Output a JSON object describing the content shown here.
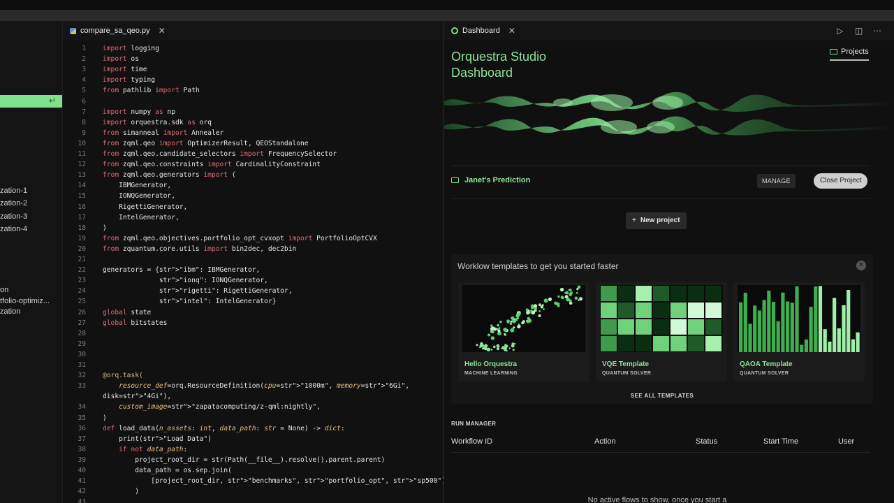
{
  "sidebar": {
    "items": [
      "zation-1",
      "zation-2",
      "zation-3",
      "zation-4",
      "on",
      "tfolio-optimiz...",
      "zation"
    ]
  },
  "editor": {
    "tab_label": "compare_sa_qeo.py",
    "lines": [
      {
        "n": "1",
        "code": "import logging"
      },
      {
        "n": "2",
        "code": "import os"
      },
      {
        "n": "3",
        "code": "import time"
      },
      {
        "n": "4",
        "code": "import typing"
      },
      {
        "n": "5",
        "code": "from pathlib import Path"
      },
      {
        "n": "6",
        "code": ""
      },
      {
        "n": "7",
        "code": "import numpy as np"
      },
      {
        "n": "8",
        "code": "import orquestra.sdk as orq"
      },
      {
        "n": "9",
        "code": "from simanneal import Annealer"
      },
      {
        "n": "10",
        "code": "from zqml.qeo import OptimizerResult, QEOStandalone"
      },
      {
        "n": "11",
        "code": "from zqml.qeo.candidate_selectors import FrequencySelector"
      },
      {
        "n": "12",
        "code": "from zqml.qeo.constraints import CardinalityConstraint"
      },
      {
        "n": "13",
        "code": "from zqml.qeo.generators import ("
      },
      {
        "n": "14",
        "code": "    IBMGenerator,"
      },
      {
        "n": "15",
        "code": "    IONQGenerator,"
      },
      {
        "n": "16",
        "code": "    RigettiGenerator,"
      },
      {
        "n": "17",
        "code": "    IntelGenerator,"
      },
      {
        "n": "18",
        "code": ")"
      },
      {
        "n": "19",
        "code": "from zqml.qeo.objectives.portfolio_opt_cvxopt import PortfolioOptCVX"
      },
      {
        "n": "20",
        "code": "from zquantum.core.utils import bin2dec, dec2bin"
      },
      {
        "n": "21",
        "code": ""
      },
      {
        "n": "22",
        "code": "generators = {\"ibm\": IBMGenerator,"
      },
      {
        "n": "23",
        "code": "              \"ionq\": IONQGenerator,"
      },
      {
        "n": "24",
        "code": "              \"rigetti\": RigettiGenerator,"
      },
      {
        "n": "25",
        "code": "              \"intel\": IntelGenerator}"
      },
      {
        "n": "26",
        "code": "global state"
      },
      {
        "n": "27",
        "code": "global bitstates"
      },
      {
        "n": "28",
        "code": ""
      },
      {
        "n": "29",
        "code": ""
      },
      {
        "n": "30",
        "code": ""
      },
      {
        "n": "31",
        "code": ""
      },
      {
        "n": "32",
        "code": "@orq.task("
      },
      {
        "n": "33",
        "code": "    resource_def=orq.ResourceDefinition(cpu=\"1000m\", memory=\"6Gi\","
      },
      {
        "n": "",
        "code": "disk=\"4Gi\"),"
      },
      {
        "n": "34",
        "code": "    custom_image=\"zapatacomputing/z-qml:nightly\","
      },
      {
        "n": "35",
        "code": ")"
      },
      {
        "n": "36",
        "code": "def load_data(n_assets: int, data_path: str = None) -> dict:"
      },
      {
        "n": "37",
        "code": "    print(\"Load Data\")"
      },
      {
        "n": "38",
        "code": "    if not data_path:"
      },
      {
        "n": "39",
        "code": "        project_root_dir = str(Path(__file__).resolve().parent.parent)"
      },
      {
        "n": "40",
        "code": "        data_path = os.sep.join("
      },
      {
        "n": "41",
        "code": "            [project_root_dir, \"benchmarks\", \"portfolio_opt\", \"sp500\"]"
      },
      {
        "n": "42",
        "code": "        )"
      },
      {
        "n": "43",
        "code": ""
      }
    ],
    "line_numbers_shown": [
      "1",
      "2",
      "3",
      "4",
      "5",
      "6",
      "7",
      "8",
      "9",
      "10",
      "11",
      "12",
      "13",
      "14",
      "15",
      "16",
      "17",
      "18",
      "19",
      "20",
      "21",
      "22",
      "23",
      "24",
      "25",
      "26",
      "27",
      "28",
      "29",
      "30",
      "31",
      "32",
      "33",
      "",
      "34",
      "35",
      "36",
      "37",
      "38",
      "39",
      "40",
      "41",
      "42",
      "43"
    ]
  },
  "dashboard": {
    "tab_label": "Dashboard",
    "title": "Orquestra Studio Dashboard",
    "projects_label": "Projects",
    "project_name": "Janet's Prediction",
    "manage_label": "MANAGE",
    "close_project_label": "Close Project",
    "new_project_label": "New project",
    "templates_heading": "Worklow templates to get you started faster",
    "templates": [
      {
        "name": "Hello Orquestra",
        "category": "MACHINE LEARNING"
      },
      {
        "name": "VQE Template",
        "category": "QUANTUM SOLVER"
      },
      {
        "name": "QAOA Template",
        "category": "QUANTUM SOLVER"
      }
    ],
    "see_all_label": "SEE ALL TEMPLATES",
    "run_manager": {
      "title": "RUN MANAGER",
      "columns": [
        "Workflow ID",
        "Action",
        "Status",
        "Start Time",
        "User"
      ],
      "empty_text": "No active flows to show, once you start a"
    }
  },
  "colors": {
    "accent": "#7ee08a",
    "background": "#101010"
  },
  "icons": [
    "python-file-icon",
    "close-icon",
    "dashboard-icon",
    "run-icon",
    "split-editor-icon",
    "more-icon",
    "folder-icon",
    "plus-icon"
  ]
}
